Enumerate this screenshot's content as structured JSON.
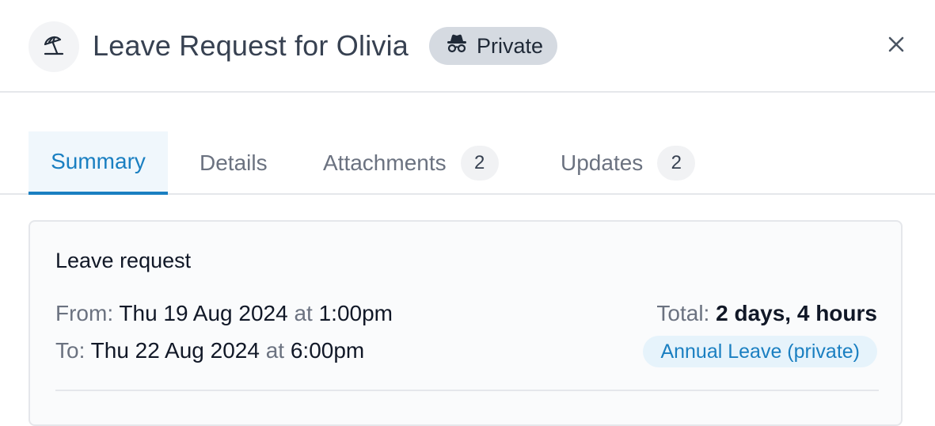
{
  "header": {
    "title": "Leave Request for Olivia",
    "badge_label": "Private",
    "icons": {
      "leading": "beach-umbrella-icon",
      "badge": "incognito-icon",
      "close": "close-icon"
    }
  },
  "tabs": [
    {
      "label": "Summary",
      "active": true
    },
    {
      "label": "Details",
      "active": false
    },
    {
      "label": "Attachments",
      "count": "2",
      "active": false
    },
    {
      "label": "Updates",
      "count": "2",
      "active": false
    }
  ],
  "card": {
    "title": "Leave request",
    "from": {
      "label": "From:",
      "date": "Thu 19 Aug 2024",
      "at": "at",
      "time": "1:00pm"
    },
    "to": {
      "label": "To:",
      "date": "Thu 22 Aug 2024",
      "at": "at",
      "time": "6:00pm"
    },
    "total_label": "Total:",
    "total_value": "2 days, 4 hours",
    "leave_type": "Annual Leave (private)"
  },
  "colors": {
    "accent": "#1a7fc1",
    "badge_bg": "#d5dae1",
    "leave_type_bg": "#e6f3fb"
  }
}
